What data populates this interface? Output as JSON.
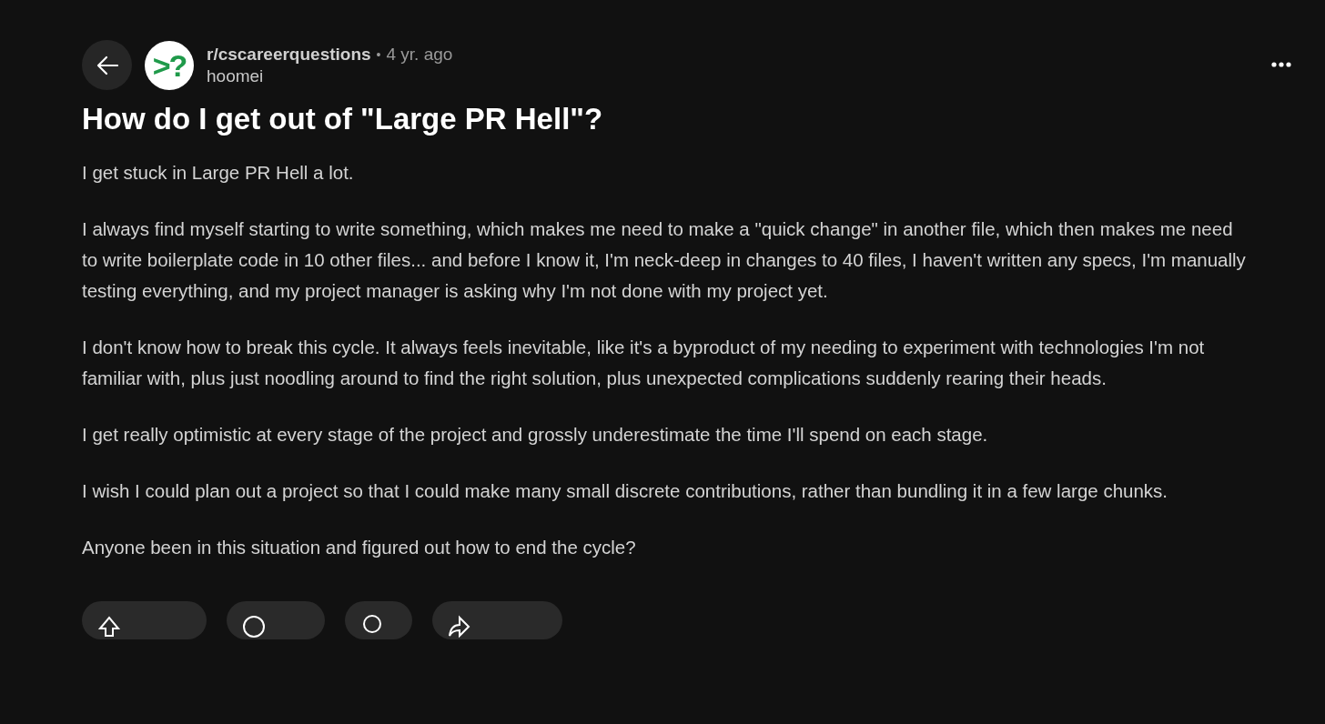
{
  "post": {
    "subreddit": "r/cscareerquestions",
    "separator": "•",
    "age": "4 yr. ago",
    "author": "hoomei",
    "avatar_logo": ">?",
    "title": "How do I get out of \"Large PR Hell\"?",
    "paragraphs": [
      "I get stuck in Large PR Hell a lot.",
      "I always find myself starting to write something, which makes me need to make a \"quick change\" in another file, which then makes me need to write boilerplate code in 10 other files... and before I know it, I'm neck-deep in changes to 40 files, I haven't written any specs, I'm manually testing everything, and my project manager is asking why I'm not done with my project yet.",
      "I don't know how to break this cycle. It always feels inevitable, like it's a byproduct of my needing to experiment with technologies I'm not familiar with, plus just noodling around to find the right solution, plus unexpected complications suddenly rearing their heads.",
      "I get really optimistic at every stage of the project and grossly underestimate the time I'll spend on each stage.",
      "I wish I could plan out a project so that I could make many small discrete contributions, rather than bundling it in a few large chunks.",
      "Anyone been in this situation and figured out how to end the cycle?"
    ],
    "actions": [
      {
        "kind": "vote"
      },
      {
        "kind": "comments"
      },
      {
        "kind": "award"
      },
      {
        "kind": "share"
      }
    ]
  }
}
